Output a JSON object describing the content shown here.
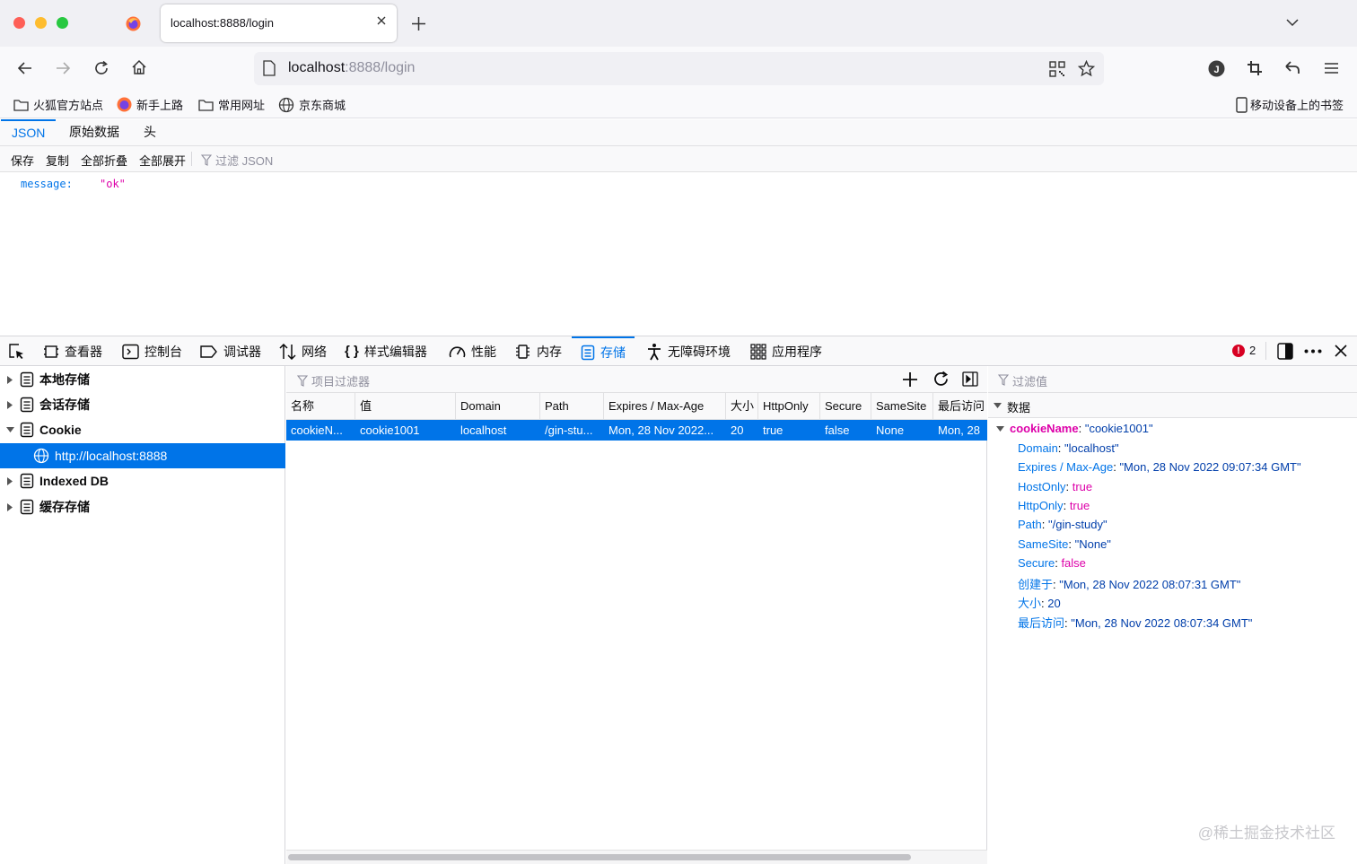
{
  "browser": {
    "tab_title": "localhost:8888/login",
    "url_host": "localhost",
    "url_rest": ":8888/login",
    "bookmarks": [
      "火狐官方站点",
      "新手上路",
      "常用网址",
      "京东商城"
    ],
    "mobile_bookmarks": "移动设备上的书签"
  },
  "json_viewer": {
    "tabs": [
      "JSON",
      "原始数据",
      "头"
    ],
    "toolbar": [
      "保存",
      "复制",
      "全部折叠",
      "全部展开"
    ],
    "filter_placeholder": "过滤 JSON",
    "key": "message:",
    "value": "\"ok\""
  },
  "devtools": {
    "tabs": [
      "查看器",
      "控制台",
      "调试器",
      "网络",
      "样式编辑器",
      "性能",
      "内存",
      "存储",
      "无障碍环境",
      "应用程序"
    ],
    "error_count": "2",
    "tree": [
      "本地存储",
      "会话存储",
      "Cookie",
      "http://localhost:8888",
      "Indexed DB",
      "缓存存储"
    ],
    "table_filter_placeholder": "项目过滤器",
    "columns": [
      "名称",
      "值",
      "Domain",
      "Path",
      "Expires / Max-Age",
      "大小",
      "HttpOnly",
      "Secure",
      "SameSite",
      "最后访问"
    ],
    "row": [
      "cookieN...",
      "cookie1001",
      "localhost",
      "/gin-stu...",
      "Mon, 28 Nov 2022...",
      "20",
      "true",
      "false",
      "None",
      "Mon, 28"
    ],
    "detail_filter_placeholder": "过滤值",
    "detail_header": "数据",
    "detail_root_key": "cookieName",
    "detail_root_value": "\"cookie1001\"",
    "detail_props": [
      {
        "k": "Domain",
        "v": "\"localhost\"",
        "t": "s"
      },
      {
        "k": "Expires / Max-Age",
        "v": "\"Mon, 28 Nov 2022 09:07:34 GMT\"",
        "t": "s"
      },
      {
        "k": "HostOnly",
        "v": "true",
        "t": "b"
      },
      {
        "k": "HttpOnly",
        "v": "true",
        "t": "b"
      },
      {
        "k": "Path",
        "v": "\"/gin-study\"",
        "t": "s"
      },
      {
        "k": "SameSite",
        "v": "\"None\"",
        "t": "s"
      },
      {
        "k": "Secure",
        "v": "false",
        "t": "b"
      },
      {
        "k": "创建于",
        "v": "\"Mon, 28 Nov 2022 08:07:31 GMT\"",
        "t": "s"
      },
      {
        "k": "大小",
        "v": "20",
        "t": "n"
      },
      {
        "k": "最后访问",
        "v": "\"Mon, 28 Nov 2022 08:07:34 GMT\"",
        "t": "s"
      }
    ]
  },
  "watermark": "@稀土掘金技术社区",
  "colors": {
    "accent": "#0074e8",
    "error": "#d70022",
    "boolean": "#dd00a9"
  }
}
